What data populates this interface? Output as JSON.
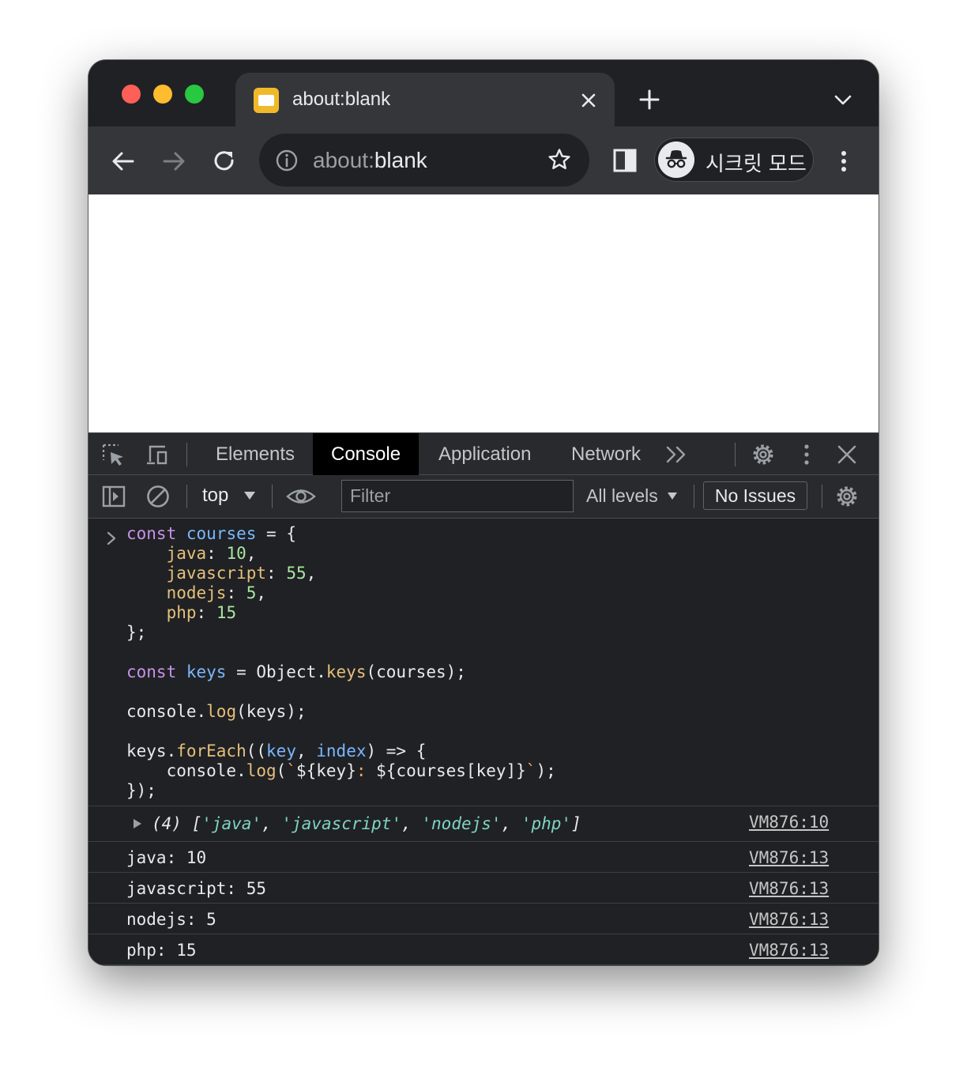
{
  "browser": {
    "tab": {
      "title": "about:blank"
    },
    "omnibox": {
      "scheme": "about:",
      "host": "blank"
    },
    "profile": {
      "label": "시크릿 모드"
    }
  },
  "devtools": {
    "tabs": [
      "Elements",
      "Console",
      "Application",
      "Network"
    ],
    "active_tab": "Console",
    "console_toolbar": {
      "context": "top",
      "filter_placeholder": "Filter",
      "levels": "All levels",
      "issues": "No Issues"
    },
    "input_code": {
      "line1": {
        "kw": "const",
        "var": "courses",
        "rest": " = {"
      },
      "props": [
        {
          "key": "java",
          "value": "10",
          "trail": ","
        },
        {
          "key": "javascript",
          "value": "55",
          "trail": ","
        },
        {
          "key": "nodejs",
          "value": "5",
          "trail": ","
        },
        {
          "key": "php",
          "value": "15",
          "trail": ""
        }
      ],
      "close1": "};",
      "line_keys": {
        "kw": "const",
        "var": "keys",
        "mid": " = Object.",
        "fn": "keys",
        "rest": "(courses);"
      },
      "line_log": {
        "obj": "console.",
        "fn": "log",
        "rest": "(keys);"
      },
      "line_foreach": {
        "obj": "keys.",
        "fn": "forEach",
        "open": "((",
        "p1": "key",
        "comma": ", ",
        "p2": "index",
        "rest": ") => {"
      },
      "line_inner": {
        "obj": "console.",
        "fn": "log",
        "open": "(",
        "tick": "`",
        "t1": "${key}",
        "colon": ":",
        "t2": " ${courses[key]}",
        "tick2": "`",
        "rest": ");"
      },
      "close2": "});"
    },
    "output": {
      "array_log": {
        "prefix": "(4) [",
        "items": [
          "'java'",
          "'javascript'",
          "'nodejs'",
          "'php'"
        ],
        "suffix": "]",
        "source": "VM876:10"
      },
      "rows": [
        {
          "text": "java: 10",
          "source": "VM876:13"
        },
        {
          "text": "javascript: 55",
          "source": "VM876:13"
        },
        {
          "text": "nodejs: 5",
          "source": "VM876:13"
        },
        {
          "text": "php: 15",
          "source": "VM876:13"
        }
      ]
    }
  }
}
